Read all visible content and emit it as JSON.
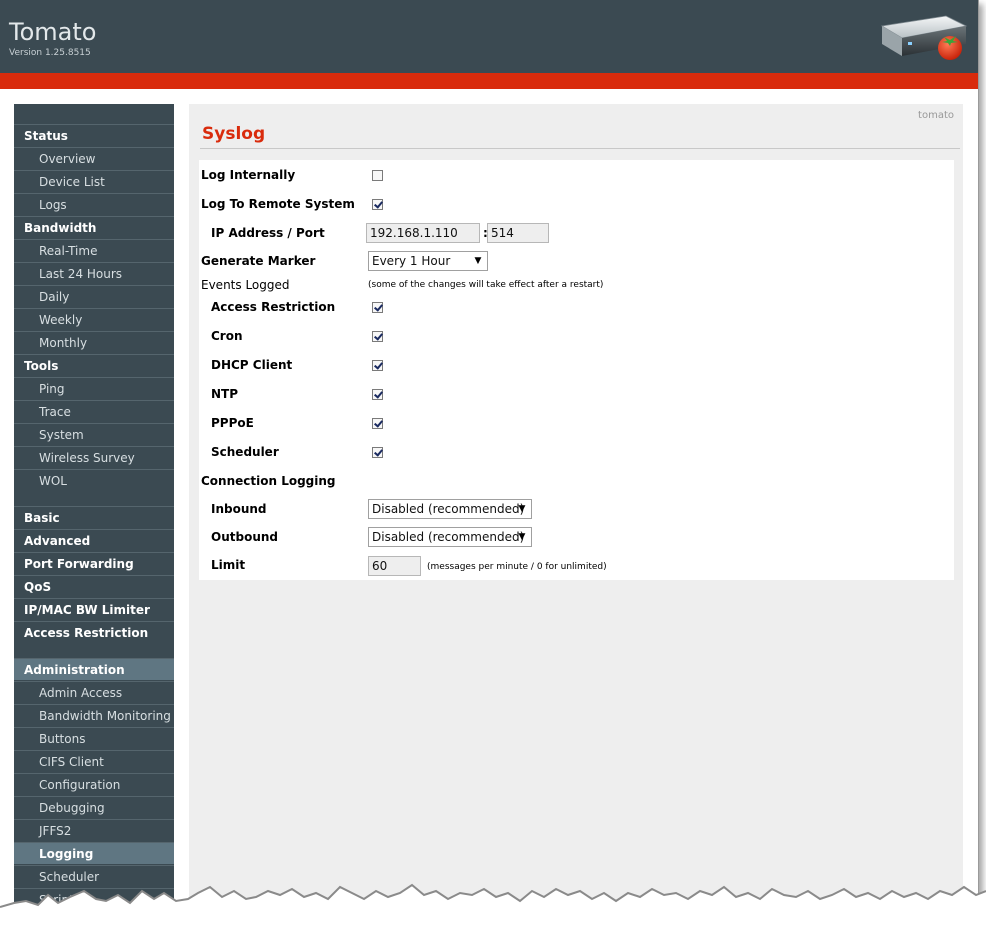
{
  "header": {
    "app_name": "Tomato",
    "version": "Version 1.25.8515"
  },
  "colors": {
    "header_bg": "#3b4a52",
    "accent_red": "#d92b0c",
    "content_bg": "#eeeeee"
  },
  "sidebar": {
    "items": [
      {
        "label": "Status",
        "level": "top"
      },
      {
        "label": "Overview",
        "level": "sub"
      },
      {
        "label": "Device List",
        "level": "sub"
      },
      {
        "label": "Logs",
        "level": "sub"
      },
      {
        "label": "Bandwidth",
        "level": "top"
      },
      {
        "label": "Real-Time",
        "level": "sub"
      },
      {
        "label": "Last 24 Hours",
        "level": "sub"
      },
      {
        "label": "Daily",
        "level": "sub"
      },
      {
        "label": "Weekly",
        "level": "sub"
      },
      {
        "label": "Monthly",
        "level": "sub"
      },
      {
        "label": "Tools",
        "level": "top"
      },
      {
        "label": "Ping",
        "level": "sub"
      },
      {
        "label": "Trace",
        "level": "sub"
      },
      {
        "label": "System",
        "level": "sub"
      },
      {
        "label": "Wireless Survey",
        "level": "sub"
      },
      {
        "label": "WOL",
        "level": "sub"
      },
      {
        "label": "Basic",
        "level": "top"
      },
      {
        "label": "Advanced",
        "level": "top"
      },
      {
        "label": "Port Forwarding",
        "level": "top"
      },
      {
        "label": "QoS",
        "level": "top"
      },
      {
        "label": "IP/MAC BW Limiter",
        "level": "top"
      },
      {
        "label": "Access Restriction",
        "level": "top"
      },
      {
        "label": "Administration",
        "level": "top",
        "state": "expanded"
      },
      {
        "label": "Admin Access",
        "level": "sub"
      },
      {
        "label": "Bandwidth Monitoring",
        "level": "sub"
      },
      {
        "label": "Buttons",
        "level": "sub"
      },
      {
        "label": "CIFS Client",
        "level": "sub"
      },
      {
        "label": "Configuration",
        "level": "sub"
      },
      {
        "label": "Debugging",
        "level": "sub"
      },
      {
        "label": "JFFS2",
        "level": "sub"
      },
      {
        "label": "Logging",
        "level": "sub",
        "state": "active"
      },
      {
        "label": "Scheduler",
        "level": "sub"
      },
      {
        "label": "Scripts",
        "level": "sub"
      }
    ]
  },
  "content": {
    "host": "tomato",
    "title": "Syslog",
    "log_internally": {
      "label": "Log Internally",
      "checked": false
    },
    "log_remote": {
      "label": "Log To Remote System",
      "checked": true
    },
    "ip_port": {
      "label": "IP Address / Port",
      "ip": "192.168.1.110",
      "sep": ":",
      "port": "514"
    },
    "marker": {
      "label": "Generate Marker",
      "value": "Every 1 Hour"
    },
    "events": {
      "label": "Events Logged",
      "note": "(some of the changes will take effect after a restart)",
      "items": [
        {
          "label": "Access Restriction",
          "checked": true
        },
        {
          "label": "Cron",
          "checked": true
        },
        {
          "label": "DHCP Client",
          "checked": true
        },
        {
          "label": "NTP",
          "checked": true
        },
        {
          "label": "PPPoE",
          "checked": true
        },
        {
          "label": "Scheduler",
          "checked": true
        }
      ]
    },
    "conn_logging": {
      "label": "Connection Logging",
      "inbound": {
        "label": "Inbound",
        "value": "Disabled (recommended)"
      },
      "outbound": {
        "label": "Outbound",
        "value": "Disabled (recommended)"
      },
      "limit": {
        "label": "Limit",
        "value": "60",
        "note": "(messages per minute / 0 for unlimited)"
      }
    }
  }
}
